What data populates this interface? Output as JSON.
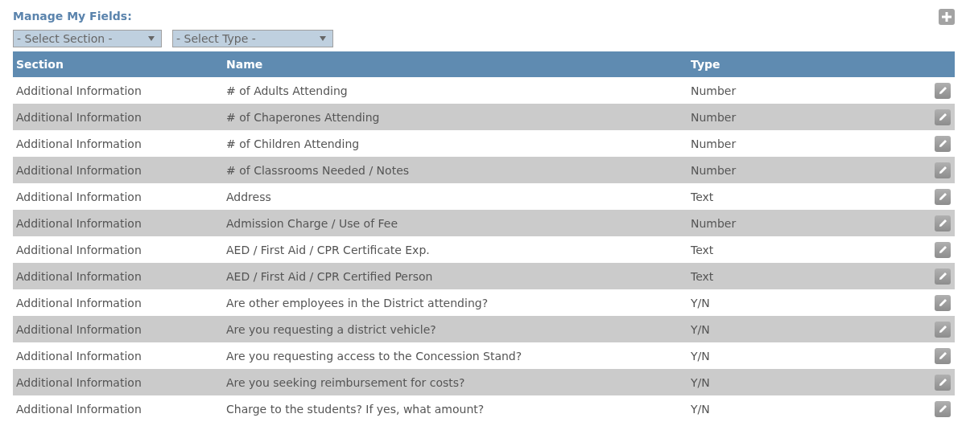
{
  "title": "Manage My Fields:",
  "filters": [
    {
      "placeholder": "- Select Section -"
    },
    {
      "placeholder": "- Select Type -"
    }
  ],
  "table": {
    "columns": [
      "Section",
      "Name",
      "Type"
    ],
    "rows": [
      {
        "section": "Additional Information",
        "name": "# of Adults Attending",
        "type": "Number"
      },
      {
        "section": "Additional Information",
        "name": "# of Chaperones Attending",
        "type": "Number"
      },
      {
        "section": "Additional Information",
        "name": "# of Children Attending",
        "type": "Number"
      },
      {
        "section": "Additional Information",
        "name": "# of Classrooms Needed / Notes",
        "type": "Number"
      },
      {
        "section": "Additional Information",
        "name": "Address",
        "type": "Text"
      },
      {
        "section": "Additional Information",
        "name": "Admission Charge / Use of Fee",
        "type": "Number"
      },
      {
        "section": "Additional Information",
        "name": "AED / First Aid / CPR Certificate Exp.",
        "type": "Text"
      },
      {
        "section": "Additional Information",
        "name": "AED / First Aid / CPR Certified Person",
        "type": "Text"
      },
      {
        "section": "Additional Information",
        "name": "Are other employees in the District attending?",
        "type": "Y/N"
      },
      {
        "section": "Additional Information",
        "name": "Are you requesting a district vehicle?",
        "type": "Y/N"
      },
      {
        "section": "Additional Information",
        "name": "Are you requesting access to the Concession Stand?",
        "type": "Y/N"
      },
      {
        "section": "Additional Information",
        "name": "Are you seeking reimbursement for costs?",
        "type": "Y/N"
      },
      {
        "section": "Additional Information",
        "name": "Charge to the students? If yes, what amount?",
        "type": "Y/N"
      }
    ]
  }
}
